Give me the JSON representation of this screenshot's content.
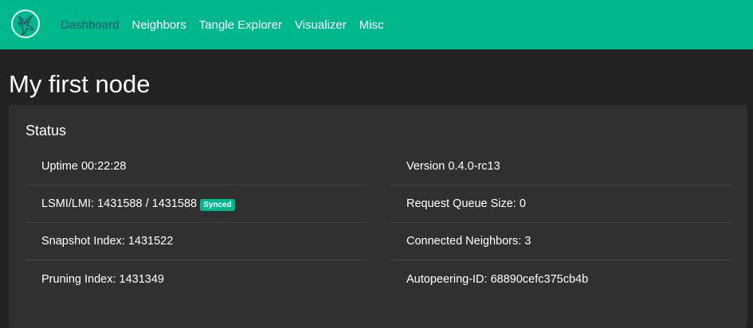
{
  "nav": {
    "items": [
      {
        "label": "Dashboard",
        "active": true
      },
      {
        "label": "Neighbors",
        "active": false
      },
      {
        "label": "Tangle Explorer",
        "active": false
      },
      {
        "label": "Visualizer",
        "active": false
      },
      {
        "label": "Misc",
        "active": false
      }
    ]
  },
  "page": {
    "title": "My first node"
  },
  "status": {
    "title": "Status",
    "uptime": "Uptime 00:22:28",
    "lsmi": "LSMI/LMI: 1431588 / 1431588",
    "synced_badge": "Synced",
    "snapshot_index": "Snapshot Index: 1431522",
    "pruning_index": "Pruning Index: 1431349",
    "version": "Version 0.4.0-rc13",
    "request_queue": "Request Queue Size: 0",
    "connected_neighbors": "Connected Neighbors: 3",
    "autopeering_id": "Autopeering-ID: 68890cefc375cb4b"
  },
  "colors": {
    "brand": "#00b88c",
    "active_nav": "#1d5a70",
    "background": "#222222",
    "card": "#303030"
  }
}
